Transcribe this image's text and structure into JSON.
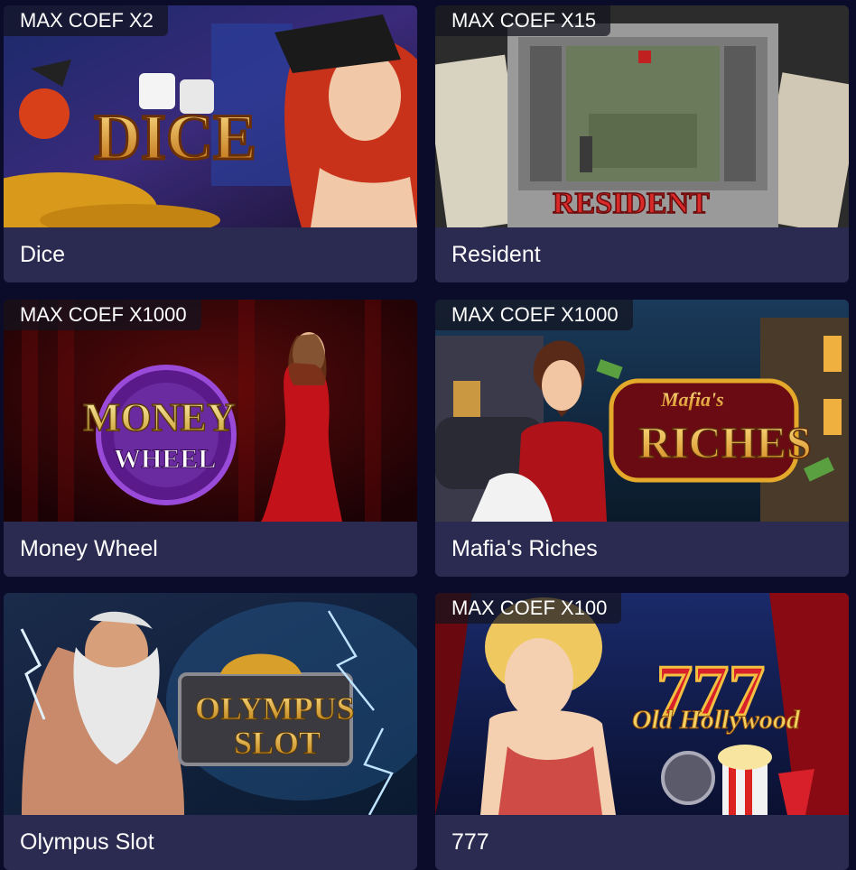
{
  "games": [
    {
      "title": "Dice",
      "badge": "MAX COEF X2",
      "art_text": "DICE"
    },
    {
      "title": "Resident",
      "badge": "MAX COEF X15",
      "art_text": "RESIDENT"
    },
    {
      "title": "Money Wheel",
      "badge": "MAX COEF X1000",
      "art_text": [
        "MONEY",
        "WHEEL"
      ]
    },
    {
      "title": "Mafia's Riches",
      "badge": "MAX COEF X1000",
      "art_text": [
        "Mafia's",
        "RICHES"
      ]
    },
    {
      "title": "Olympus Slot",
      "badge": "",
      "art_text": [
        "OLYMPUS",
        "SLOT"
      ]
    },
    {
      "title": "777",
      "badge": "MAX COEF X100",
      "art_text": [
        "777",
        "Old Hollywood"
      ]
    }
  ],
  "colors": {
    "page_bg": "#0b0b2a",
    "card_footer": "#2b2a50",
    "badge_bg": "rgba(20,20,30,0.72)",
    "text": "#ffffff"
  }
}
